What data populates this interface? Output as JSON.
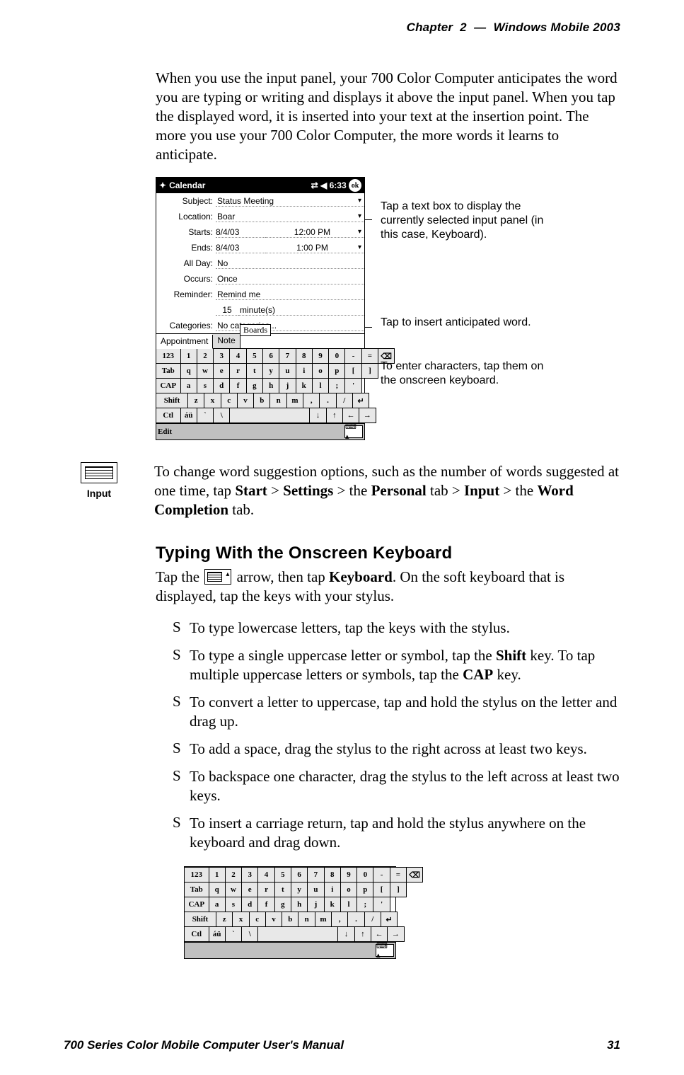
{
  "header": {
    "chapter_label": "Chapter",
    "chapter_number": "2",
    "dash": "—",
    "title": "Windows Mobile 2003"
  },
  "intro_para": "When you use the input panel, your 700 Color Computer anticipates the word you are typing or writing and displays it above the input panel. When you tap the displayed word, it is inserted into your text at the insertion point. The more you use your 700 Color Computer, the more words it learns to anticipate.",
  "pda": {
    "app": "Calendar",
    "time": "6:33",
    "ok": "ok",
    "subject_label": "Subject:",
    "subject_value": "Status Meeting",
    "location_label": "Location:",
    "location_value": "Boar",
    "starts_label": "Starts:",
    "starts_date": "8/4/03",
    "starts_time": "12:00 PM",
    "ends_label": "Ends:",
    "ends_date": "8/4/03",
    "ends_time": "1:00 PM",
    "allday_label": "All Day:",
    "allday_value": "No",
    "occurs_label": "Occurs:",
    "occurs_value": "Once",
    "reminder_label": "Reminder:",
    "reminder_value": "Remind me",
    "reminder_qty": "15",
    "reminder_unit": "minute(s)",
    "categories_label": "Categories:",
    "categories_value": "No categories...",
    "tab1": "Appointment",
    "tab2": "Note",
    "suggestion": "Boards",
    "edit": "Edit"
  },
  "annotations": {
    "a1": "Tap a text box to display the currently selected input panel (in this case, Keyboard).",
    "a2": "Tap to insert anticipated word.",
    "a3": "To enter characters, tap them on the onscreen keyboard."
  },
  "input_caption": "Input",
  "change_para_parts": {
    "pre": "To change word suggestion options, such as the number of words suggested at one time, tap ",
    "s1": "Start",
    "gt1": " > ",
    "s2": "Settings",
    "gt2": " > the ",
    "s3": "Personal",
    "mid": " tab > ",
    "s4": "Input",
    "gt3": " > the ",
    "s5": "Word Completion",
    "post": " tab."
  },
  "heading": "Typing With the Onscreen Keyboard",
  "kb_para": {
    "pre": "Tap the ",
    "mid": " arrow, then tap ",
    "kb": "Keyboard",
    "post": ". On the soft keyboard that is displayed, tap the keys with your stylus."
  },
  "bullets": {
    "b1": "To type lowercase letters, tap the keys with the stylus.",
    "b2a": "To type a single uppercase letter or symbol, tap the ",
    "b2_shift": "Shift",
    "b2b": " key. To tap multiple uppercase letters or symbols, tap the ",
    "b2_cap": "CAP",
    "b2c": " key.",
    "b3": "To convert a letter to uppercase, tap and hold the stylus on the letter and drag up.",
    "b4": "To add a space, drag the stylus to the right across at least two keys.",
    "b5": "To backspace one character, drag the stylus to the left across at least two keys.",
    "b6": "To insert a carriage return, tap and hold the stylus anywhere on the keyboard and drag down."
  },
  "keyboard": {
    "r1": [
      "123",
      "1",
      "2",
      "3",
      "4",
      "5",
      "6",
      "7",
      "8",
      "9",
      "0",
      "-",
      "=",
      "⌫"
    ],
    "r2": [
      "Tab",
      "q",
      "w",
      "e",
      "r",
      "t",
      "y",
      "u",
      "i",
      "o",
      "p",
      "[",
      "]"
    ],
    "r3": [
      "CAP",
      "a",
      "s",
      "d",
      "f",
      "g",
      "h",
      "j",
      "k",
      "l",
      ";",
      "'"
    ],
    "r4": [
      "Shift",
      "z",
      "x",
      "c",
      "v",
      "b",
      "n",
      "m",
      ",",
      ".",
      "/",
      "↵"
    ],
    "r5": [
      "Ctl",
      "áü",
      "`",
      "\\",
      " ",
      "↓",
      "↑",
      "←",
      "→"
    ]
  },
  "footer": {
    "left": "700 Series Color Mobile Computer User's Manual",
    "right": "31"
  }
}
